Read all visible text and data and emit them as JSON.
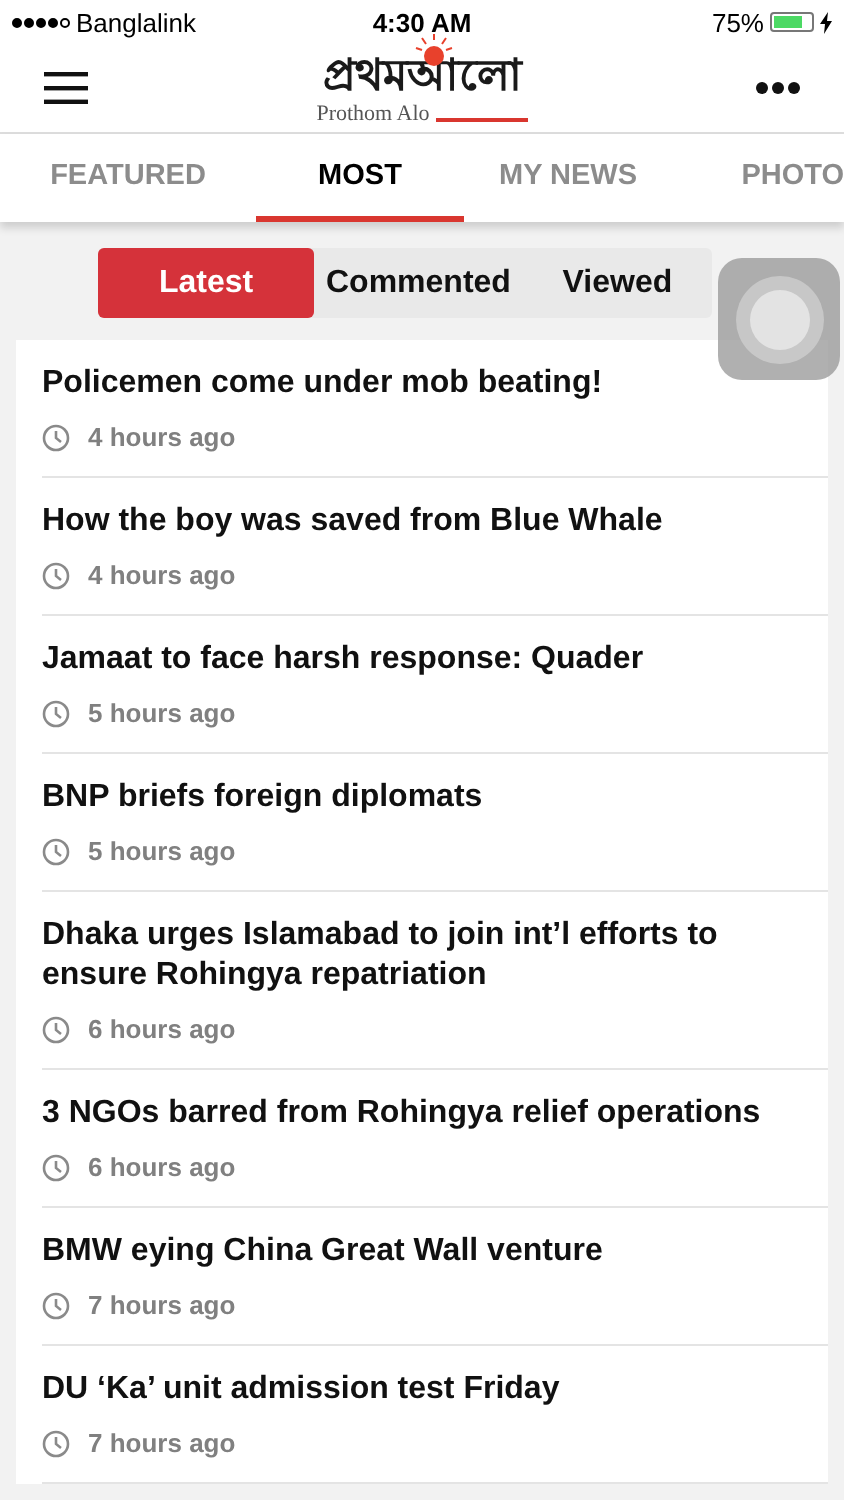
{
  "status_bar": {
    "carrier": "Banglalink",
    "time": "4:30 AM",
    "battery": "75%"
  },
  "header": {
    "logo": "প্রথমআলো",
    "logo_subtitle": "Prothom Alo"
  },
  "tabs": [
    {
      "label": "FEATURED",
      "selected": false
    },
    {
      "label": "MOST",
      "selected": true
    },
    {
      "label": "MY NEWS",
      "selected": false
    },
    {
      "label": "PHOTO",
      "selected": false
    }
  ],
  "segments": [
    {
      "label": "Latest",
      "selected": true
    },
    {
      "label": "Commented",
      "selected": false
    },
    {
      "label": "Viewed",
      "selected": false
    }
  ],
  "articles": [
    {
      "title": "Policemen come under mob beating!",
      "time": "4 hours ago"
    },
    {
      "title": "How the boy was saved from Blue Whale",
      "time": "4 hours ago"
    },
    {
      "title": "Jamaat to face harsh response: Quader",
      "time": "5 hours ago"
    },
    {
      "title": "BNP briefs foreign diplomats",
      "time": "5 hours ago"
    },
    {
      "title": "Dhaka urges Islamabad to join int’l efforts to ensure Rohingya repatriation",
      "time": "6 hours ago"
    },
    {
      "title": "3 NGOs barred from Rohingya relief operations",
      "time": "6 hours ago"
    },
    {
      "title": "BMW eying China Great Wall venture",
      "time": "7 hours ago"
    },
    {
      "title": "DU ‘Ka’ unit admission test Friday",
      "time": "7 hours ago"
    }
  ]
}
